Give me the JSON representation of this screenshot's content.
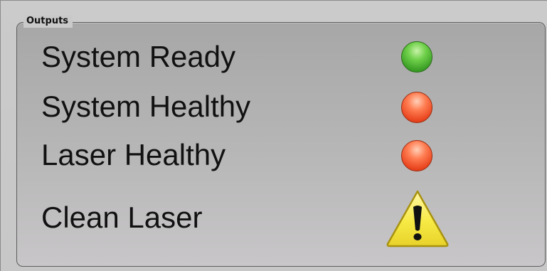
{
  "group": {
    "title": "Outputs"
  },
  "outputs": [
    {
      "label": "System Ready",
      "status": "ok",
      "color": "#4cbb2f",
      "icon": "green-led-icon"
    },
    {
      "label": "System Healthy",
      "status": "fault",
      "color": "#f0512a",
      "icon": "red-led-icon"
    },
    {
      "label": "Laser Healthy",
      "status": "fault",
      "color": "#f0512a",
      "icon": "red-led-icon"
    },
    {
      "label": "Clean Laser",
      "status": "warning",
      "color": "#f2e33a",
      "icon": "warning-icon"
    }
  ]
}
